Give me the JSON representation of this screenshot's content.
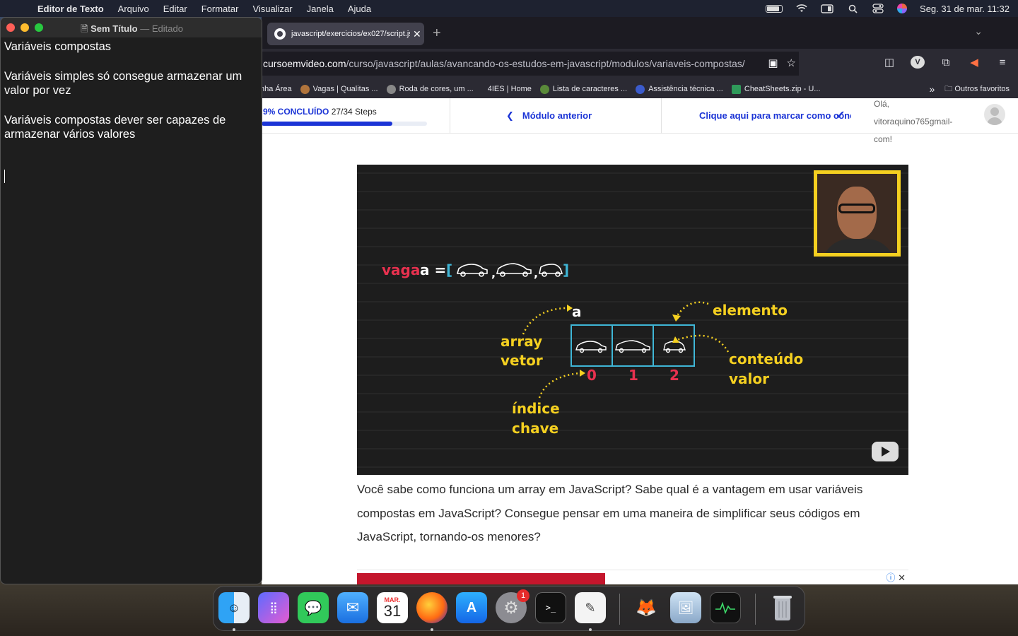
{
  "menubar": {
    "app_name": "Editor de Texto",
    "menus": [
      "Arquivo",
      "Editar",
      "Formatar",
      "Visualizar",
      "Janela",
      "Ajuda"
    ],
    "datetime": "Seg. 31 de mar.  11:32"
  },
  "editor": {
    "title": "Sem Título",
    "separator": "—",
    "status": "Editado",
    "lines": [
      "Variáveis compostas",
      "Variáveis simples só consegue armazenar um valor por vez",
      "Variáveis compostas dever ser capazes de armazenar vários valores"
    ]
  },
  "browser": {
    "tab_title": "javascript/exercicios/ex027/script.js",
    "url_domain": "cursoemvideo.com",
    "url_path": "/curso/javascript/aulas/avancando-os-estudos-em-javascript/modulos/variaveis-compostas/",
    "bookmarks": [
      "nha Área",
      "Vagas | Qualitas ...",
      "Roda de cores, um ...",
      "4IES | Home",
      "Lista de caracteres ...",
      "Assistência técnica ...",
      "CheatSheets.zip - U..."
    ],
    "other_bookmarks": "Outros favoritos"
  },
  "course": {
    "progress_pct_label": "9% CONCLUÍDO",
    "steps_label": "27/34 Steps",
    "progress_fraction": 0.79,
    "prev_module": "Módulo anterior",
    "mark_complete": "Clique aqui para marcar como concluído",
    "greeting": "Olá, vitoraquino765gmail-com!"
  },
  "video": {
    "vaga": "vaga",
    "a_eq": "a  =",
    "bracket_open": "[",
    "bracket_close": "]",
    "a_label": "a",
    "elemento": "elemento",
    "array": "array",
    "vetor": "vetor",
    "conteudo": "conteúdo",
    "valor": "valor",
    "indice": "índice",
    "chave": "chave",
    "indices": [
      "0",
      "1",
      "2"
    ],
    "colors": {
      "yellow": "#f5d020",
      "red": "#e8314f",
      "cyan": "#3fb6d6",
      "white": "#ffffff"
    }
  },
  "article": {
    "paragraph": "Você sabe como funciona um array em JavaScript? Sabe qual é a vantagem em usar variáveis compostas em JavaScript? Consegue pensar em uma maneira de simplificar seus códigos em JavaScript, tornando-os menores?"
  },
  "dock": {
    "calendar_month": "MAR.",
    "calendar_day": "31",
    "settings_badge": "1"
  }
}
